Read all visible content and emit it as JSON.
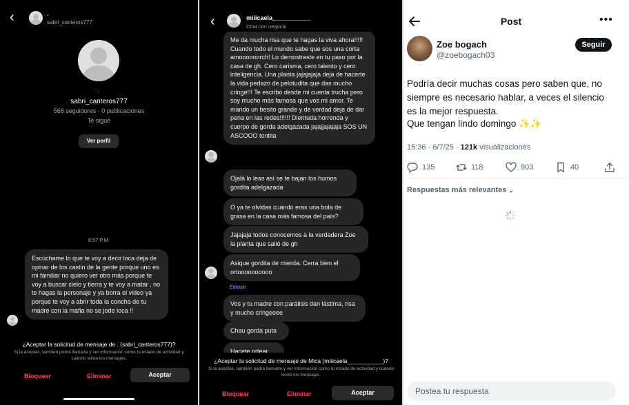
{
  "panel1": {
    "header_username": "sabri_canteros777",
    "header_dot": ".",
    "profile_dot": ".",
    "profile_username": "sabri_canteros777",
    "stats": "568 seguidores · 0 publicaciones",
    "follows_you": "Te sigue",
    "view_profile": "Ver perfil",
    "time": "8:57 P.M.",
    "message": "Escúchame lo que te voy a decir loca deja de opinar de los castin de la gente porque uno es mi familiar no quiero ver otro más porque te voy a buscar cielo y tierra y te voy a matar , no te hagas la personaje y ya borra el video ya porque te voy a abrir toda la concha de tu madre con la mafia no se jode loca !!",
    "request_title": "¿Aceptar la solicitud de mensaje de . (sabri_canteros777)?",
    "request_sub": "Si la aceptas, también podrá llamarte y ver información como tu estado de actividad y cuándo leíste los mensajes.",
    "block": "Bloquear",
    "delete": "Eliminar",
    "accept": "Aceptar"
  },
  "panel2": {
    "header_username": "miiicaela___________",
    "header_sub": "Chat con negocio",
    "msg1": "Me da mucha risa que te hagas la viva ahora!!!!! Cuando todo el mundo sabe que sos una corta amoooooorch! Lo demostraste en tu paso por la casa de gh. Cero carisma, cero talento y cero inteligencia. Una planta jajajajaja deja de hacerte la vida pedazo de pelotudita que das mucho cringe!!! Te escribo desde mi cuenta trucha pero soy mucho más famosa que vos mi amor. Te mando un besito grande y de verdad deja de dar pena en las redes!!!!!! Dientuda horrenda y cuerpo de gorda adelgazada jajajjajajaja SOS UN ASCOOO tontita",
    "msg2": "Ojalá lo leas así se te bajan los humos gordita adelgazada",
    "msg3": "O ya te olvidas cuando eras una bola de grasa en la casa más famosa del país?",
    "msg4": "Jajajaja todos conocemos a la verdadera Zoe la planta que salió de gh",
    "msg5": "Asique gordita de mierda. Cerra bien el ortoooooooooo",
    "edited": "Editado",
    "msg6": "Vos y tu madre con parálisis dan lástima, risa y mucho cringeeee",
    "msg7": "Chau gorda puta",
    "msg8": "Hacete ortear",
    "request_title": "¿Aceptar la solicitud de mensaje de Mica (miiicaela___________)?",
    "request_sub": "Si la aceptas, también podrá llamarte y ver información como tu estado de actividad y cuándo leíste los mensajes.",
    "block": "Bloquear",
    "delete": "Eliminar",
    "accept": "Aceptar"
  },
  "panel3": {
    "title": "Post",
    "name": "Zoe bogach",
    "handle": "@zoebogach03",
    "follow": "Seguir",
    "body_line1": "Podría decir muchas cosas pero saben que, no siempre es necesario hablar, a veces el silencio es la mejor respuesta.",
    "body_line2": "Que tengan lindo domingo ✨✨",
    "meta_time": "15:36 · 6/7/25 · ",
    "meta_views_count": "121k",
    "meta_views_label": " visualizaciones",
    "replies": "135",
    "reposts": "118",
    "likes": "903",
    "bookmarks": "40",
    "sort_label": "Respuestas más relevantes",
    "reply_placeholder": "Postea tu respuesta"
  },
  "colors": {
    "ig_bubble": "#262626",
    "ig_red": "#ff3b5c",
    "ig_link": "#8ea3ff",
    "tw_text": "#0f1419",
    "tw_muted": "#536471"
  }
}
